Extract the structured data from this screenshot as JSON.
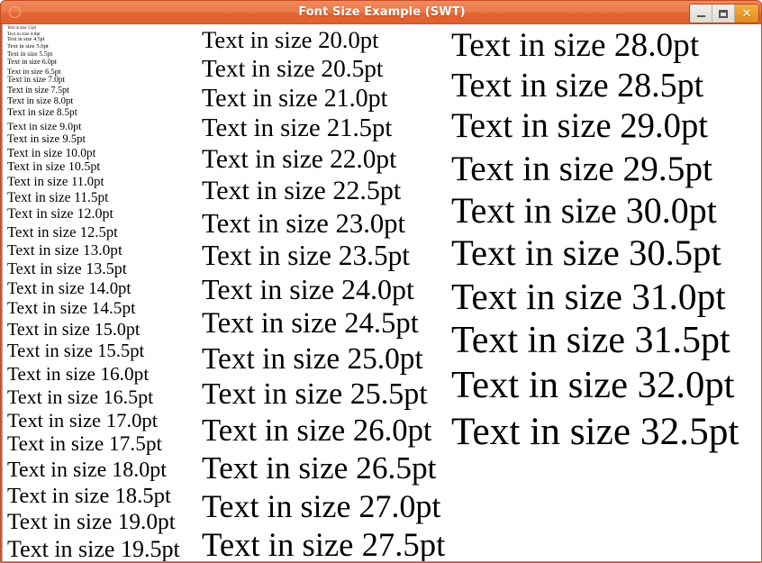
{
  "window": {
    "title": "Font Size Example (SWT)",
    "icon": "circle-icon",
    "accent_color": "#e8663a",
    "titlebar_text_color": "#ffffff",
    "close_button_color": "#e08a1c",
    "client_background": "#ffffff",
    "text_color": "#000000"
  },
  "titlebar_buttons": [
    {
      "name": "minimize",
      "label": "–"
    },
    {
      "name": "maximize",
      "label": "☐"
    },
    {
      "name": "close",
      "label": "✕"
    }
  ],
  "content": {
    "label_prefix": "Text in size ",
    "label_suffix": "pt",
    "size_step": 0.5,
    "size_min": 3.5,
    "size_max": 32.5,
    "columns": [
      {
        "name": "column-1",
        "lines": [
          {
            "text": "Text in size 3.5pt",
            "size_pt": 3.5
          },
          {
            "text": "Text in size 4.0pt",
            "size_pt": 4.0
          },
          {
            "text": "Text in size 4.5pt",
            "size_pt": 4.5
          },
          {
            "text": "Text in size 5.0pt",
            "size_pt": 5.0
          },
          {
            "text": "Text in size 5.5pt",
            "size_pt": 5.5
          },
          {
            "text": "Text in size 6.0pt",
            "size_pt": 6.0
          },
          {
            "text": "Text in size 6.5pt",
            "size_pt": 6.5
          },
          {
            "text": "Text in size 7.0pt",
            "size_pt": 7.0
          },
          {
            "text": "Text in size 7.5pt",
            "size_pt": 7.5
          },
          {
            "text": "Text in size 8.0pt",
            "size_pt": 8.0
          },
          {
            "text": "Text in size 8.5pt",
            "size_pt": 8.5
          },
          {
            "text": "Text in size 9.0pt",
            "size_pt": 9.0
          },
          {
            "text": "Text in size 9.5pt",
            "size_pt": 9.5
          },
          {
            "text": "Text in size 10.0pt",
            "size_pt": 10.0
          },
          {
            "text": "Text in size 10.5pt",
            "size_pt": 10.5
          },
          {
            "text": "Text in size 11.0pt",
            "size_pt": 11.0
          },
          {
            "text": "Text in size 11.5pt",
            "size_pt": 11.5
          },
          {
            "text": "Text in size 12.0pt",
            "size_pt": 12.0
          },
          {
            "text": "Text in size 12.5pt",
            "size_pt": 12.5
          },
          {
            "text": "Text in size 13.0pt",
            "size_pt": 13.0
          },
          {
            "text": "Text in size 13.5pt",
            "size_pt": 13.5
          },
          {
            "text": "Text in size 14.0pt",
            "size_pt": 14.0
          },
          {
            "text": "Text in size 14.5pt",
            "size_pt": 14.5
          },
          {
            "text": "Text in size 15.0pt",
            "size_pt": 15.0
          },
          {
            "text": "Text in size 15.5pt",
            "size_pt": 15.5
          },
          {
            "text": "Text in size 16.0pt",
            "size_pt": 16.0
          },
          {
            "text": "Text in size 16.5pt",
            "size_pt": 16.5
          },
          {
            "text": "Text in size 17.0pt",
            "size_pt": 17.0
          },
          {
            "text": "Text in size 17.5pt",
            "size_pt": 17.5
          },
          {
            "text": "Text in size 18.0pt",
            "size_pt": 18.0
          },
          {
            "text": "Text in size 18.5pt",
            "size_pt": 18.5
          },
          {
            "text": "Text in size 19.0pt",
            "size_pt": 19.0
          },
          {
            "text": "Text in size 19.5pt",
            "size_pt": 19.5
          }
        ]
      },
      {
        "name": "column-2",
        "lines": [
          {
            "text": "Text in size 20.0pt",
            "size_pt": 20.0
          },
          {
            "text": "Text in size 20.5pt",
            "size_pt": 20.5
          },
          {
            "text": "Text in size 21.0pt",
            "size_pt": 21.0
          },
          {
            "text": "Text in size 21.5pt",
            "size_pt": 21.5
          },
          {
            "text": "Text in size 22.0pt",
            "size_pt": 22.0
          },
          {
            "text": "Text in size 22.5pt",
            "size_pt": 22.5
          },
          {
            "text": "Text in size 23.0pt",
            "size_pt": 23.0
          },
          {
            "text": "Text in size 23.5pt",
            "size_pt": 23.5
          },
          {
            "text": "Text in size 24.0pt",
            "size_pt": 24.0
          },
          {
            "text": "Text in size 24.5pt",
            "size_pt": 24.5
          },
          {
            "text": "Text in size 25.0pt",
            "size_pt": 25.0
          },
          {
            "text": "Text in size 25.5pt",
            "size_pt": 25.5
          },
          {
            "text": "Text in size 26.0pt",
            "size_pt": 26.0
          },
          {
            "text": "Text in size 26.5pt",
            "size_pt": 26.5
          },
          {
            "text": "Text in size 27.0pt",
            "size_pt": 27.0
          },
          {
            "text": "Text in size 27.5pt",
            "size_pt": 27.5
          }
        ]
      },
      {
        "name": "column-3",
        "lines": [
          {
            "text": "Text in size 28.0pt",
            "size_pt": 28.0
          },
          {
            "text": "Text in size 28.5pt",
            "size_pt": 28.5
          },
          {
            "text": "Text in size 29.0pt",
            "size_pt": 29.0
          },
          {
            "text": "Text in size 29.5pt",
            "size_pt": 29.5
          },
          {
            "text": "Text in size 30.0pt",
            "size_pt": 30.0
          },
          {
            "text": "Text in size 30.5pt",
            "size_pt": 30.5
          },
          {
            "text": "Text in size 31.0pt",
            "size_pt": 31.0
          },
          {
            "text": "Text in size 31.5pt",
            "size_pt": 31.5
          },
          {
            "text": "Text in size 32.0pt",
            "size_pt": 32.0
          },
          {
            "text": "Text in size 32.5pt",
            "size_pt": 32.5
          }
        ]
      }
    ]
  }
}
